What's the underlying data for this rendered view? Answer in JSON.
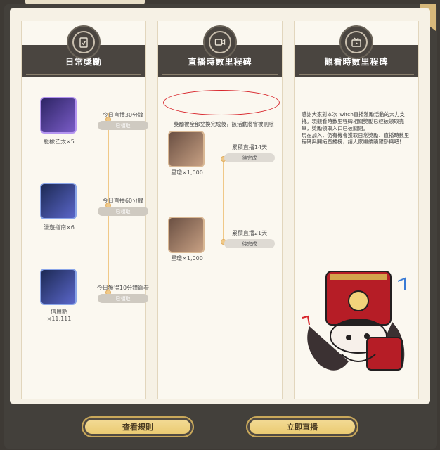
{
  "panels": [
    {
      "title": "日常獎勵",
      "icon": "clipboard-check-icon",
      "items": [
        {
          "reward": "脈檬乙太×5",
          "task": "今日直播30分鐘",
          "status": "已領取"
        },
        {
          "reward": "漫遊指南×6",
          "task": "今日直播60分鐘",
          "status": "已領取"
        },
        {
          "reward": "信用點\n×11,111",
          "task": "今日獲得10分鐘觀看",
          "status": "已領取"
        }
      ]
    },
    {
      "title": "直播時數里程碑",
      "icon": "video-camera-icon",
      "notice": "獎勵被全部兌換完成後，該活動將會被刪除",
      "items": [
        {
          "reward": "星瓊×1,000",
          "task": "累積直播14天",
          "status": "待完成"
        },
        {
          "reward": "星瓊×1,000",
          "task": "累積直播21天",
          "status": "待完成"
        }
      ]
    },
    {
      "title": "觀看時數里程碑",
      "icon": "tv-icon",
      "body": "感謝大家對本次Twitch直播激勵活動的大力支持。現觀看時數里程碑相關獎勵已經被領取完畢，獎勵領取入口已被關閉。\n現在加入，仍有機會獲取日常獎勵、直播時數里程碑與開拓直播榜，請大家繼續踴躍參與吧！"
    }
  ],
  "buttons": {
    "rules": "查看規則",
    "live": "立即直播"
  },
  "colors": {
    "accent": "#f0c988",
    "panel_head": "#4a4540",
    "notice_circle": "#d8252b"
  }
}
